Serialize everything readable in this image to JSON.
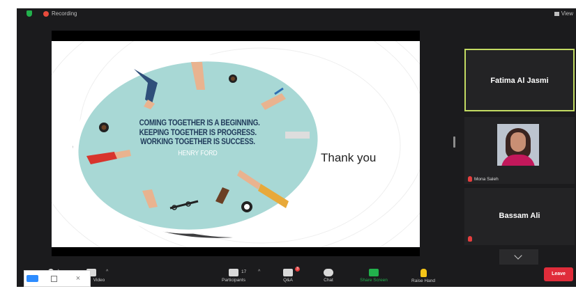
{
  "topbar": {
    "recording_label": "Recording",
    "view_label": "View"
  },
  "slide": {
    "quote_lines": [
      "COMING TOGETHER IS A BEGINNING.",
      "KEEPING TOGETHER IS PROGRESS.",
      "WORKING TOGETHER IS SUCCESS."
    ],
    "author": "HENRY FORD",
    "thank_you": "Thank you"
  },
  "participants": [
    {
      "name": "Fatima Al Jasmi",
      "active_speaker": true
    },
    {
      "name": "Mona Saleh",
      "video": true,
      "muted": true
    },
    {
      "name": "Bassam Ali",
      "muted": true
    }
  ],
  "toolbar": {
    "video_label": "Video",
    "participants_label": "Participants",
    "participants_count": "17",
    "qa_label": "Q&A",
    "qa_badge": "3",
    "chat_label": "Chat",
    "share_label": "Share Screen",
    "raise_label": "Raise Hand",
    "leave_label": "Leave"
  },
  "colors": {
    "active_speaker_border": "#c3db62",
    "share_green": "#22b14c",
    "leave_red": "#e02c3a",
    "slide_teal": "#a8d8d5"
  },
  "icons": {
    "shield": "shield-icon",
    "recording": "recording-dot-icon",
    "mic_muted": "mic-muted-icon",
    "chevron": "chevron-down-icon"
  }
}
